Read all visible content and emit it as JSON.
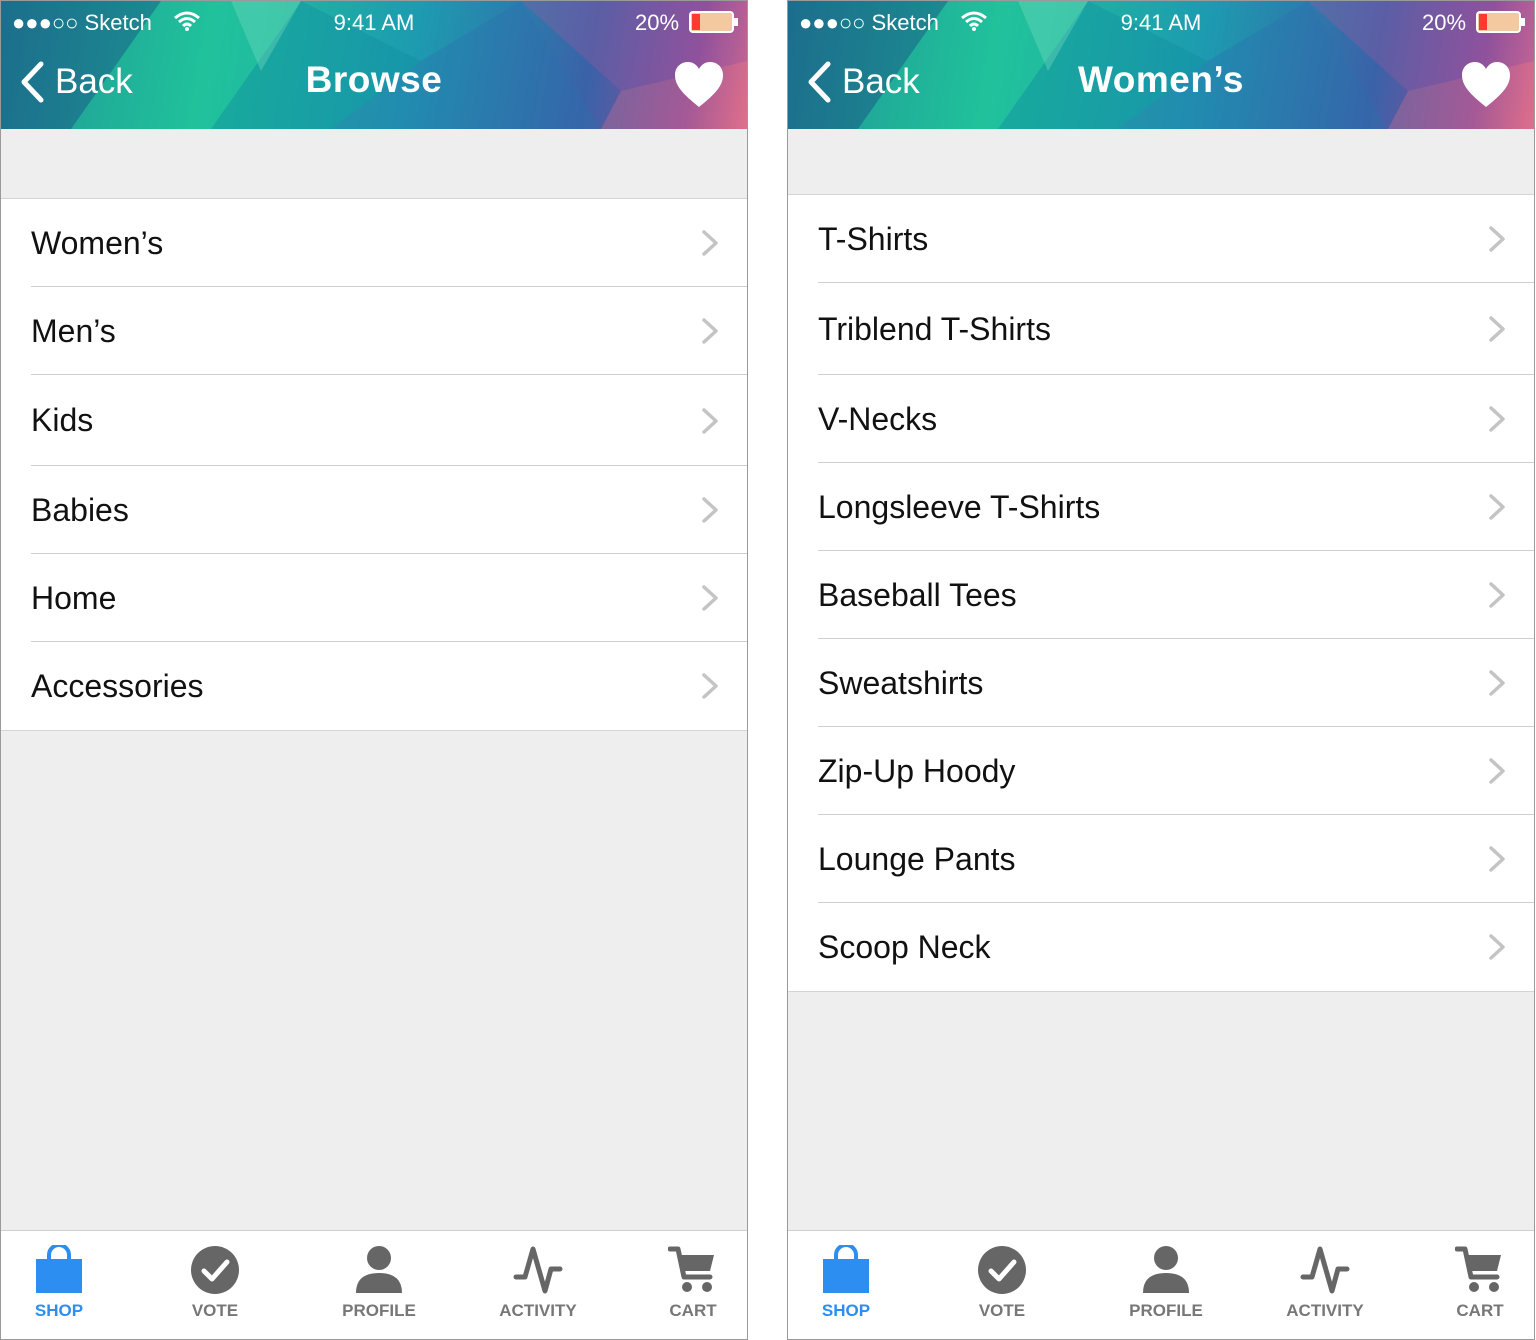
{
  "screens": [
    {
      "status": {
        "carrier": "●●●○○ Sketch",
        "time": "9:41 AM",
        "battery": "20%"
      },
      "nav": {
        "back_label": "Back",
        "title": "Browse"
      },
      "items": [
        "Women’s",
        "Men’s",
        "Kids",
        "Babies",
        "Home",
        "Accessories"
      ],
      "tabs": [
        "SHOP",
        "VOTE",
        "PROFILE",
        "ACTIVITY",
        "CART"
      ],
      "active_tab": "SHOP"
    },
    {
      "status": {
        "carrier": "●●●○○ Sketch",
        "time": "9:41 AM",
        "battery": "20%"
      },
      "nav": {
        "back_label": "Back",
        "title": "Women’s"
      },
      "items": [
        "T-Shirts",
        "Triblend T-Shirts",
        "V-Necks",
        "Longsleeve T-Shirts",
        "Baseball Tees",
        "Sweatshirts",
        "Zip-Up Hoody",
        "Lounge Pants",
        "Scoop Neck"
      ],
      "tabs": [
        "SHOP",
        "VOTE",
        "PROFILE",
        "ACTIVITY",
        "CART"
      ],
      "active_tab": "SHOP"
    }
  ],
  "colors": {
    "accent": "#2b8ef0",
    "inactive_tab": "#777777",
    "background": "#eeeeee"
  },
  "icons": {
    "tabs": [
      "shopping-bag-icon",
      "checkmark-circle-icon",
      "person-icon",
      "activity-pulse-icon",
      "cart-icon"
    ]
  }
}
